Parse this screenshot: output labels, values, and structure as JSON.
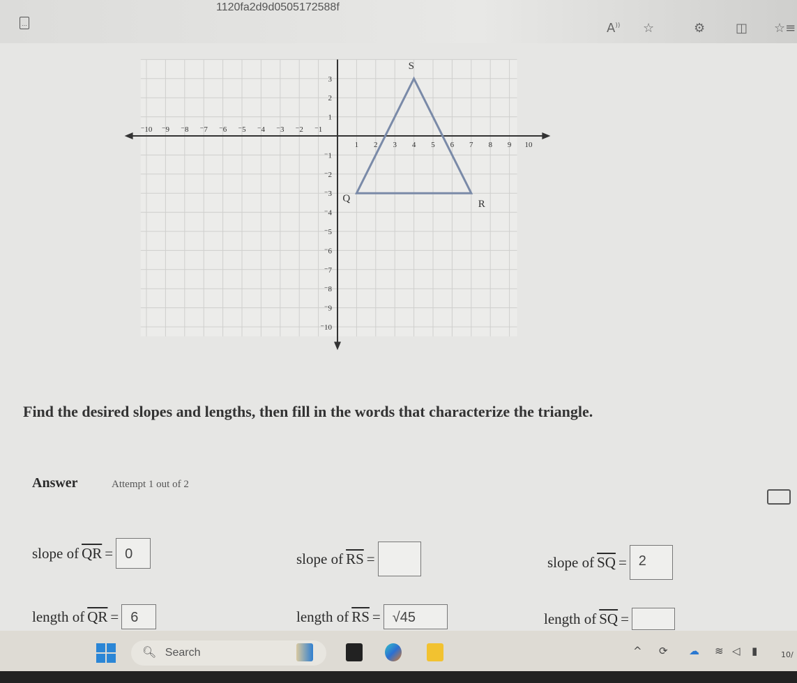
{
  "browser": {
    "url_fragment": "1120fa2d9d0505172588f",
    "toolbar_icons": [
      "read-aloud-icon",
      "favorite-star-icon",
      "extensions-icon",
      "split-screen-icon",
      "favorites-list-icon"
    ]
  },
  "graph": {
    "x_range": [
      -10,
      10
    ],
    "y_range": [
      -10,
      3
    ],
    "x_ticks": [
      -10,
      -9,
      -8,
      -7,
      -6,
      -5,
      -4,
      -3,
      -2,
      -1,
      1,
      2,
      3,
      4,
      5,
      6,
      7,
      8,
      9,
      10
    ],
    "y_ticks": [
      3,
      2,
      1,
      -1,
      -2,
      -3,
      -4,
      -5,
      -6,
      -7,
      -8,
      -9,
      -10
    ],
    "points": [
      {
        "label": "Q",
        "x": 1,
        "y": -3
      },
      {
        "label": "R",
        "x": 7,
        "y": -3
      },
      {
        "label": "S",
        "x": 4,
        "y": 3
      }
    ],
    "line_color": "#7a8aa8"
  },
  "question": "Find the desired slopes and lengths, then fill in the words that characterize the triangle.",
  "answer": {
    "heading": "Answer",
    "attempt": "Attempt 1 out of 2",
    "slope_prefix": "slope of",
    "length_prefix": "length of",
    "eq": "=",
    "slopes": [
      {
        "segment": "QR",
        "value": "0"
      },
      {
        "segment": "RS",
        "value": ""
      },
      {
        "segment": "SQ",
        "value": "2"
      }
    ],
    "lengths": [
      {
        "segment": "QR",
        "value": "6"
      },
      {
        "segment": "RS",
        "value": "√45"
      },
      {
        "segment": "SQ",
        "value": ""
      }
    ]
  },
  "taskbar": {
    "search_placeholder": "Search",
    "clock": "10/"
  }
}
